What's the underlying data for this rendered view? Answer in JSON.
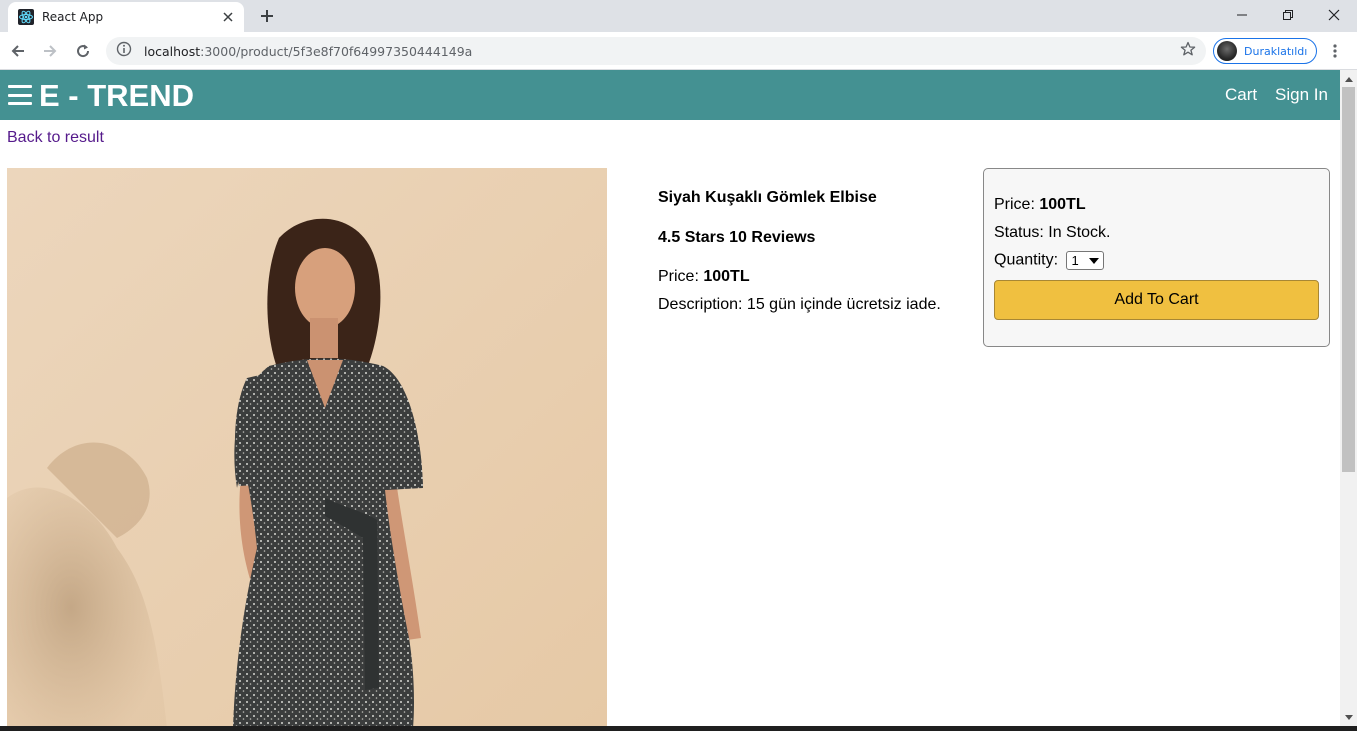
{
  "browser": {
    "tab_title": "React App",
    "url_host": "localhost",
    "url_path": ":3000/product/5f3e8f70f64997350444149a",
    "profile_label": "Duraklatıldı"
  },
  "header": {
    "brand": "E - TREND",
    "links": [
      "Cart",
      "Sign In"
    ]
  },
  "page": {
    "back_link": "Back to result"
  },
  "product": {
    "name": "Siyah Kuşaklı Gömlek Elbise",
    "rating_text": "4.5 Stars 10 Reviews",
    "price_label": "Price: ",
    "price_value": "100TL",
    "description": "Description: 15 gün içinde ücretsiz iade."
  },
  "action": {
    "price_label": "Price: ",
    "price_value": "100TL",
    "status": "Status: In Stock.",
    "quantity_label": "Quantity: ",
    "quantity_selected": "1",
    "add_button": "Add To Cart"
  },
  "colors": {
    "header_bg": "#449192",
    "button_bg": "#f0c040",
    "link_color": "#551a8b"
  }
}
